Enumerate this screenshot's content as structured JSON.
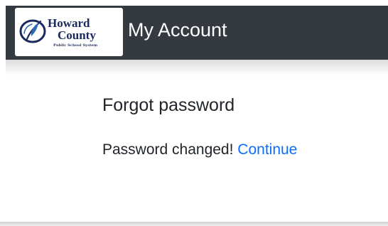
{
  "header": {
    "logo": {
      "line1": "Howard",
      "line2": "County",
      "line3": "Public School System",
      "brand_color": "#1b2a5e",
      "accent_color": "#2f6bb3",
      "icon": "flame-emblem-icon"
    },
    "title": "My Account",
    "background": "#343a40"
  },
  "main": {
    "heading": "Forgot password",
    "message": "Password changed!",
    "link_label": "Continue",
    "link_color": "#0d6efd"
  }
}
